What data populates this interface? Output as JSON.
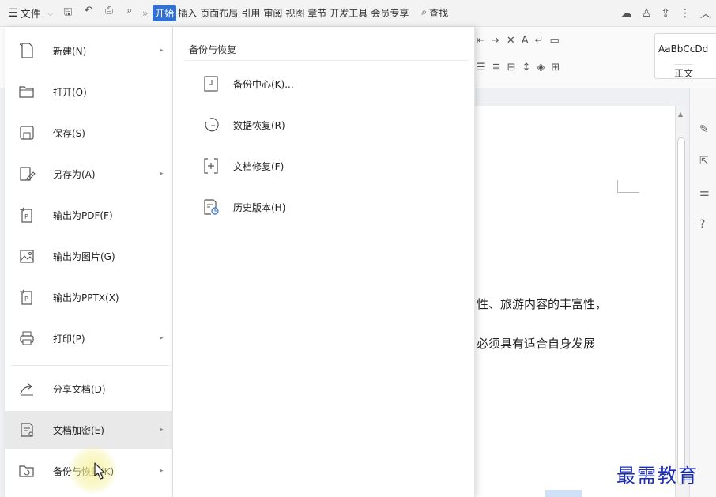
{
  "toolbar": {
    "file_label": "文件",
    "menu_icon": "hamburger-icon",
    "quick_icons": [
      "save-icon",
      "undo-icon",
      "print-icon",
      "print-preview-icon"
    ],
    "tabs": [
      {
        "label": "开始",
        "active": true
      },
      {
        "label": "插入"
      },
      {
        "label": "页面布局"
      },
      {
        "label": "引用"
      },
      {
        "label": "审阅"
      },
      {
        "label": "视图"
      },
      {
        "label": "章节"
      },
      {
        "label": "开发工具"
      },
      {
        "label": "会员专享"
      }
    ],
    "search_label": "查找",
    "accent_color": "#2f6fd6"
  },
  "ribbon": {
    "style_sample": "AaBbCcDd",
    "style_name": "正文"
  },
  "file_menu": {
    "items": [
      {
        "label": "新建(N)",
        "icon": "new-file-icon",
        "submenu": true
      },
      {
        "label": "打开(O)",
        "icon": "folder-open-icon",
        "submenu": false
      },
      {
        "label": "保存(S)",
        "icon": "save-icon",
        "submenu": false
      },
      {
        "label": "另存为(A)",
        "icon": "save-as-icon",
        "submenu": true
      },
      {
        "label": "输出为PDF(F)",
        "icon": "export-pdf-icon",
        "submenu": false
      },
      {
        "label": "输出为图片(G)",
        "icon": "export-image-icon",
        "submenu": false
      },
      {
        "label": "输出为PPTX(X)",
        "icon": "export-pptx-icon",
        "submenu": false
      },
      {
        "label": "打印(P)",
        "icon": "printer-icon",
        "submenu": true
      },
      {
        "label": "分享文档(D)",
        "icon": "share-icon",
        "submenu": false
      },
      {
        "label": "文档加密(E)",
        "icon": "encrypt-icon",
        "submenu": true,
        "hovered": true
      },
      {
        "label": "备份与恢复(K)",
        "icon": "backup-icon",
        "submenu": true
      }
    ]
  },
  "submenu": {
    "header": "备份与恢复",
    "items": [
      {
        "label": "备份中心(K)...",
        "icon": "backup-center-icon"
      },
      {
        "label": "数据恢复(R)",
        "icon": "data-recovery-icon"
      },
      {
        "label": "文档修复(F)",
        "icon": "document-repair-icon"
      },
      {
        "label": "历史版本(H)",
        "icon": "history-version-icon"
      }
    ]
  },
  "document": {
    "line1": "性、旅游内容的丰富性，",
    "line2": "必须具有适合自身发展"
  },
  "watermark": "最需教育"
}
